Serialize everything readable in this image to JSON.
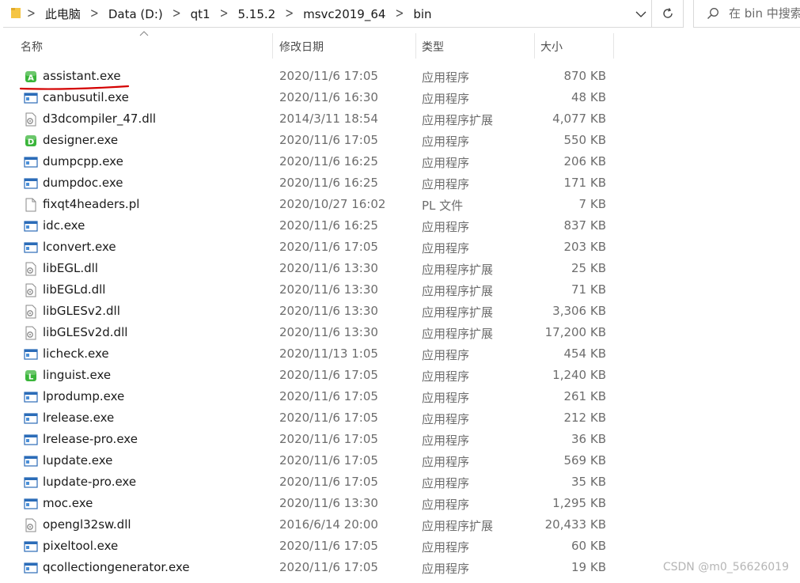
{
  "breadcrumb": [
    "此电脑",
    "Data (D:)",
    "qt1",
    "5.15.2",
    "msvc2019_64",
    "bin"
  ],
  "search": {
    "placeholder": "在 bin 中搜索"
  },
  "columns": {
    "name": "名称",
    "date": "修改日期",
    "type": "类型",
    "size": "大小"
  },
  "files": [
    {
      "name": "assistant.exe",
      "date": "2020/11/6 17:05",
      "type": "应用程序",
      "size": "870 KB",
      "icon": "assistant-app-icon",
      "badge": "A",
      "color": "#3ab53a"
    },
    {
      "name": "canbusutil.exe",
      "date": "2020/11/6 16:30",
      "type": "应用程序",
      "size": "48 KB",
      "icon": "exe-window-icon"
    },
    {
      "name": "d3dcompiler_47.dll",
      "date": "2014/3/11 18:54",
      "type": "应用程序扩展",
      "size": "4,077 KB",
      "icon": "dll-gear-icon"
    },
    {
      "name": "designer.exe",
      "date": "2020/11/6 17:05",
      "type": "应用程序",
      "size": "550 KB",
      "icon": "designer-app-icon",
      "badge": "D",
      "color": "#3ab53a"
    },
    {
      "name": "dumpcpp.exe",
      "date": "2020/11/6 16:25",
      "type": "应用程序",
      "size": "206 KB",
      "icon": "exe-window-icon"
    },
    {
      "name": "dumpdoc.exe",
      "date": "2020/11/6 16:25",
      "type": "应用程序",
      "size": "171 KB",
      "icon": "exe-window-icon"
    },
    {
      "name": "fixqt4headers.pl",
      "date": "2020/10/27 16:02",
      "type": "PL 文件",
      "size": "7 KB",
      "icon": "blank-file-icon"
    },
    {
      "name": "idc.exe",
      "date": "2020/11/6 16:25",
      "type": "应用程序",
      "size": "837 KB",
      "icon": "exe-window-icon"
    },
    {
      "name": "lconvert.exe",
      "date": "2020/11/6 17:05",
      "type": "应用程序",
      "size": "203 KB",
      "icon": "exe-window-icon"
    },
    {
      "name": "libEGL.dll",
      "date": "2020/11/6 13:30",
      "type": "应用程序扩展",
      "size": "25 KB",
      "icon": "dll-gear-icon"
    },
    {
      "name": "libEGLd.dll",
      "date": "2020/11/6 13:30",
      "type": "应用程序扩展",
      "size": "71 KB",
      "icon": "dll-gear-icon"
    },
    {
      "name": "libGLESv2.dll",
      "date": "2020/11/6 13:30",
      "type": "应用程序扩展",
      "size": "3,306 KB",
      "icon": "dll-gear-icon"
    },
    {
      "name": "libGLESv2d.dll",
      "date": "2020/11/6 13:30",
      "type": "应用程序扩展",
      "size": "17,200 KB",
      "icon": "dll-gear-icon"
    },
    {
      "name": "licheck.exe",
      "date": "2020/11/13 1:05",
      "type": "应用程序",
      "size": "454 KB",
      "icon": "exe-window-icon"
    },
    {
      "name": "linguist.exe",
      "date": "2020/11/6 17:05",
      "type": "应用程序",
      "size": "1,240 KB",
      "icon": "linguist-app-icon",
      "badge": "L",
      "color": "#3ab53a"
    },
    {
      "name": "lprodump.exe",
      "date": "2020/11/6 17:05",
      "type": "应用程序",
      "size": "261 KB",
      "icon": "exe-window-icon"
    },
    {
      "name": "lrelease.exe",
      "date": "2020/11/6 17:05",
      "type": "应用程序",
      "size": "212 KB",
      "icon": "exe-window-icon"
    },
    {
      "name": "lrelease-pro.exe",
      "date": "2020/11/6 17:05",
      "type": "应用程序",
      "size": "36 KB",
      "icon": "exe-window-icon"
    },
    {
      "name": "lupdate.exe",
      "date": "2020/11/6 17:05",
      "type": "应用程序",
      "size": "569 KB",
      "icon": "exe-window-icon"
    },
    {
      "name": "lupdate-pro.exe",
      "date": "2020/11/6 17:05",
      "type": "应用程序",
      "size": "35 KB",
      "icon": "exe-window-icon"
    },
    {
      "name": "moc.exe",
      "date": "2020/11/6 13:30",
      "type": "应用程序",
      "size": "1,295 KB",
      "icon": "exe-window-icon"
    },
    {
      "name": "opengl32sw.dll",
      "date": "2016/6/14 20:00",
      "type": "应用程序扩展",
      "size": "20,433 KB",
      "icon": "dll-gear-icon"
    },
    {
      "name": "pixeltool.exe",
      "date": "2020/11/6 17:05",
      "type": "应用程序",
      "size": "60 KB",
      "icon": "exe-window-icon"
    },
    {
      "name": "qcollectiongenerator.exe",
      "date": "2020/11/6 17:05",
      "type": "应用程序",
      "size": "19 KB",
      "icon": "exe-window-icon"
    }
  ],
  "annotation": {
    "color": "#d40000"
  },
  "watermark": "CSDN @m0_56626019"
}
